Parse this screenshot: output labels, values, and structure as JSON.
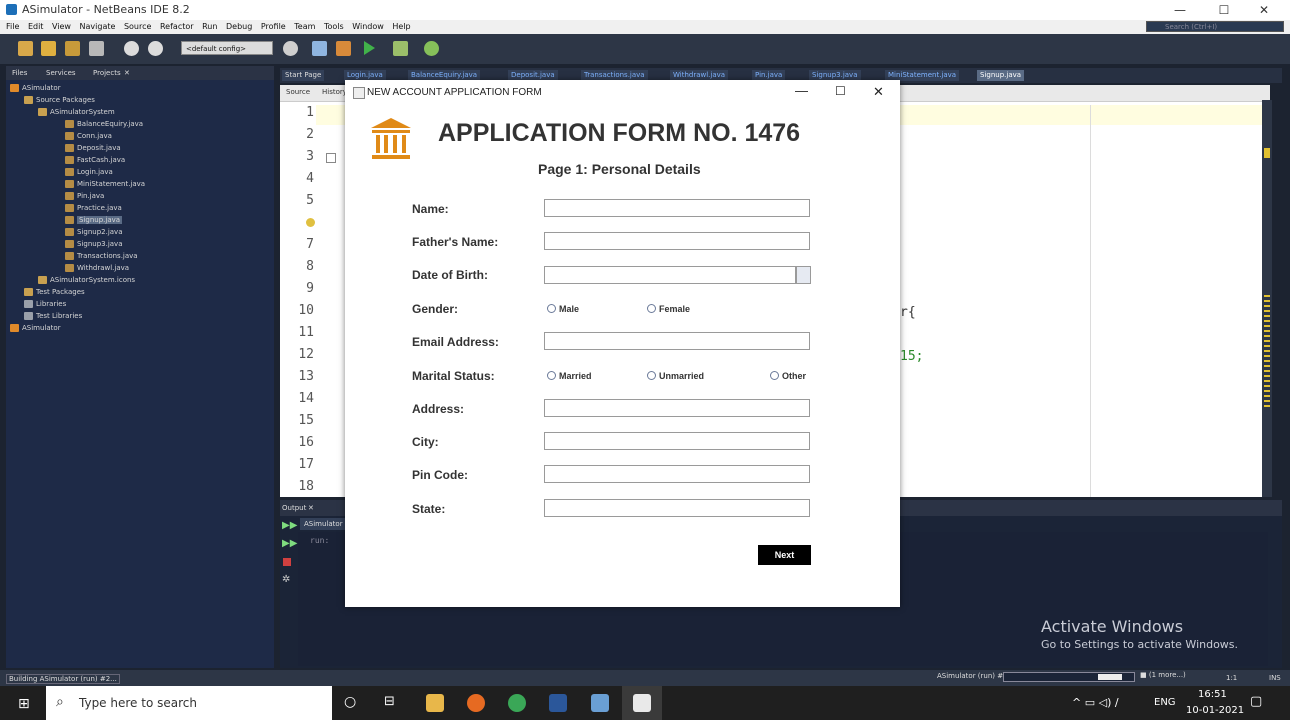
{
  "window": {
    "title": "ASimulator - NetBeans IDE 8.2"
  },
  "menu": [
    "File",
    "Edit",
    "View",
    "Navigate",
    "Source",
    "Refactor",
    "Run",
    "Debug",
    "Profile",
    "Team",
    "Tools",
    "Window",
    "Help"
  ],
  "search": {
    "placeholder": "Search (Ctrl+I)"
  },
  "toolbar": {
    "config": "<default config>"
  },
  "left_tabs": [
    "Files",
    "Services",
    "Projects"
  ],
  "tree": [
    {
      "label": "ASimulator",
      "level": 0
    },
    {
      "label": "Source Packages",
      "level": 1
    },
    {
      "label": "ASimulatorSystem",
      "level": 2
    },
    {
      "label": "BalanceEquiry.java",
      "level": 3
    },
    {
      "label": "Conn.java",
      "level": 3
    },
    {
      "label": "Deposit.java",
      "level": 3
    },
    {
      "label": "FastCash.java",
      "level": 3
    },
    {
      "label": "Login.java",
      "level": 3
    },
    {
      "label": "MiniStatement.java",
      "level": 3
    },
    {
      "label": "Pin.java",
      "level": 3
    },
    {
      "label": "Practice.java",
      "level": 3
    },
    {
      "label": "Signup.java",
      "level": 3
    },
    {
      "label": "Signup2.java",
      "level": 3
    },
    {
      "label": "Signup3.java",
      "level": 3
    },
    {
      "label": "Transactions.java",
      "level": 3
    },
    {
      "label": "Withdrawl.java",
      "level": 3
    },
    {
      "label": "ASimulatorSystem.icons",
      "level": 2
    },
    {
      "label": "Test Packages",
      "level": 1
    },
    {
      "label": "Libraries",
      "level": 1
    },
    {
      "label": "Test Libraries",
      "level": 1
    },
    {
      "label": "ASimulator",
      "level": 0
    }
  ],
  "editor_tabs": [
    "Start Page",
    "Login.java",
    "BalanceEquiry.java",
    "Deposit.java",
    "Transactions.java",
    "Withdrawl.java",
    "Pin.java",
    "Signup3.java",
    "MiniStatement.java",
    "Signup.java"
  ],
  "editor": {
    "source_label": "Source",
    "history_label": "History",
    "line_numbers": [
      "1",
      "2",
      "3",
      "4",
      "5",
      "6",
      "7",
      "8",
      "9",
      "10",
      "11",
      "12",
      "13",
      "14",
      "15",
      "16",
      "17",
      "18"
    ],
    "fragment1": "r{",
    "fragment2": "15;"
  },
  "output": {
    "title": "Output",
    "tab": "ASimulator",
    "text": "run:"
  },
  "status": {
    "left": "Building ASimulator (run) #2...",
    "task": "ASimulator (run) #2",
    "more": "(1 more...)",
    "pos": "1:1",
    "mode": "INS"
  },
  "dialog": {
    "title": "NEW ACCOUNT APPLICATION FORM",
    "heading": "APPLICATION FORM NO. 1476",
    "subheading": "Page 1: Personal Details",
    "labels": {
      "name": "Name:",
      "father": "Father's Name:",
      "dob": "Date of Birth:",
      "gender": "Gender:",
      "email": "Email Address:",
      "marital": "Marital Status:",
      "address": "Address:",
      "city": "City:",
      "pin": "Pin Code:",
      "state": "State:"
    },
    "gender_options": [
      "Male",
      "Female"
    ],
    "marital_options": [
      "Married",
      "Unmarried",
      "Other"
    ],
    "next": "Next"
  },
  "watermark": {
    "title": "Activate Windows",
    "subtitle": "Go to Settings to activate Windows."
  },
  "taskbar": {
    "search_placeholder": "Type here to search",
    "lang": "ENG",
    "time": "16:51",
    "date": "10-01-2021"
  }
}
